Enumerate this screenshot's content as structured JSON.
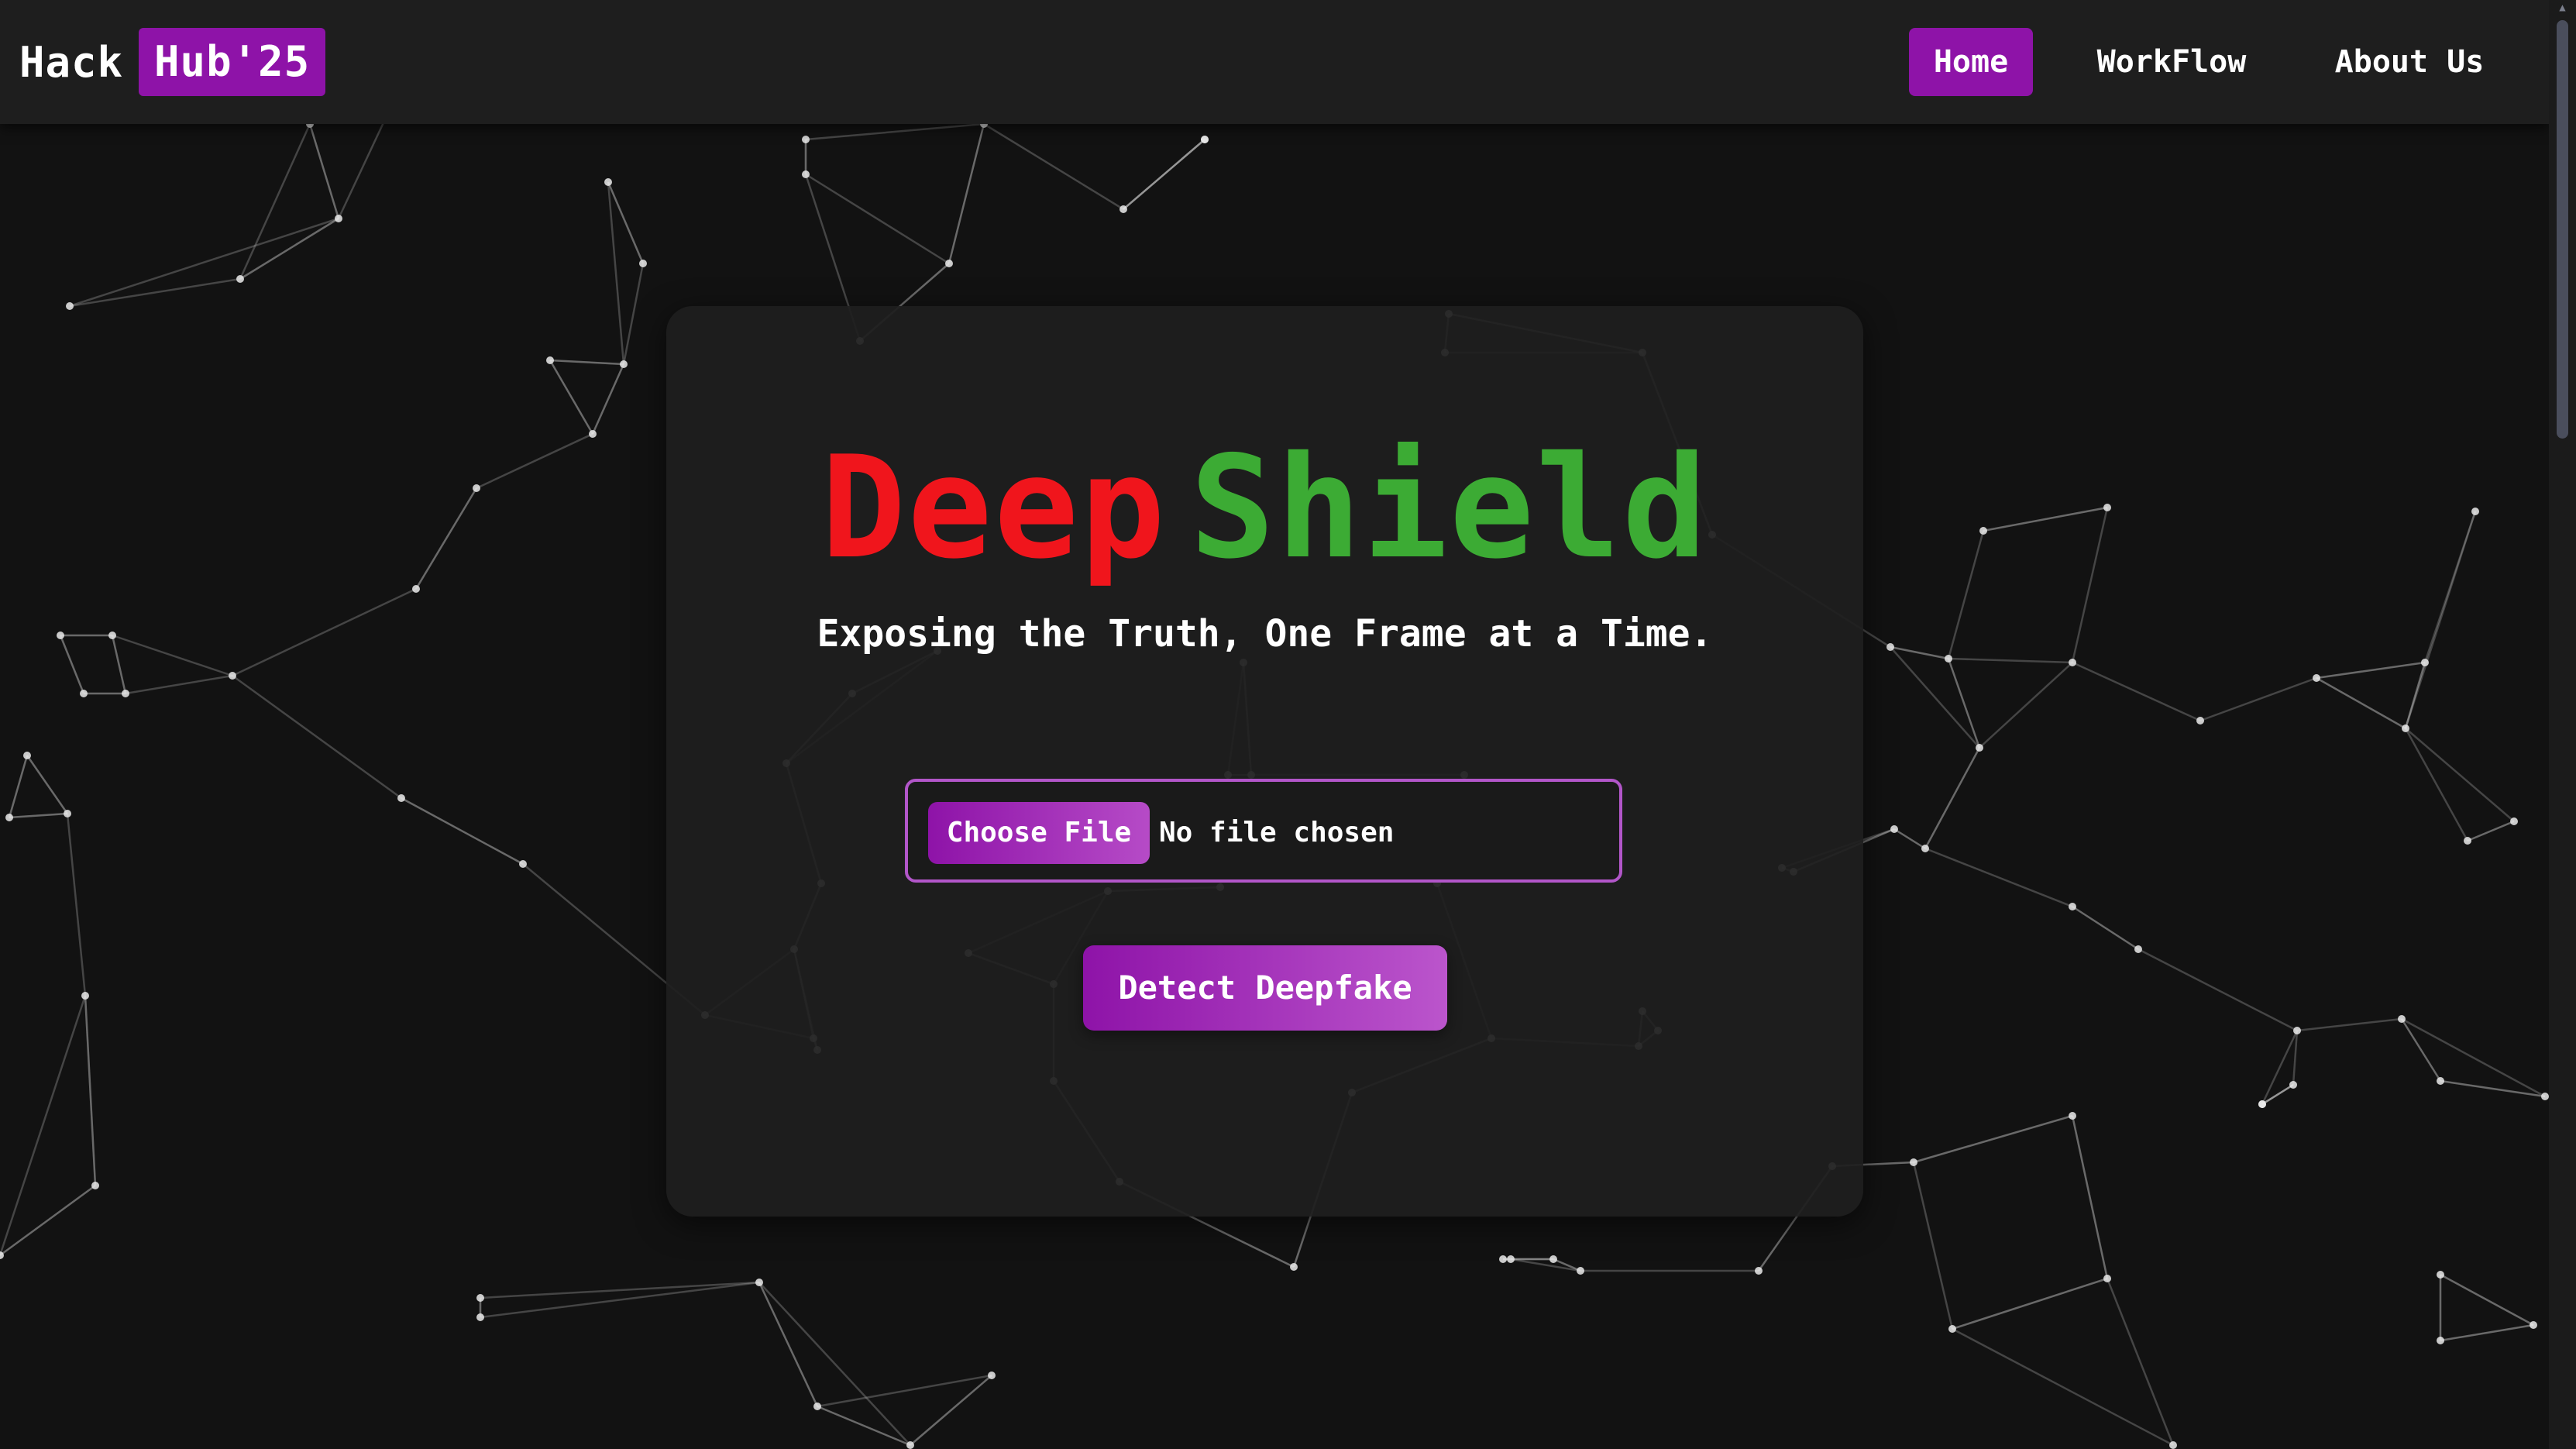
{
  "navbar": {
    "logo_text": "Hack",
    "logo_badge": "Hub'25",
    "links": [
      {
        "label": "Home",
        "active": true
      },
      {
        "label": "WorkFlow",
        "active": false
      },
      {
        "label": "About Us",
        "active": false
      }
    ]
  },
  "hero": {
    "title_part1": "Deep",
    "title_part2": "Shield",
    "tagline": "Exposing the Truth, One Frame at a Time."
  },
  "upload": {
    "choose_file_label": "Choose File",
    "file_status": "No file chosen"
  },
  "actions": {
    "detect_label": "Detect Deepfake"
  },
  "colors": {
    "background": "#121212",
    "navbar": "#1e1e1e",
    "card": "#1e1e1e",
    "accent": "#8e13a8",
    "title_deep": "#f0151c",
    "title_shield": "#3cab34",
    "picker_border": "#b256c9"
  },
  "icons": {
    "scroll_up": "scroll-up-arrow-icon"
  }
}
